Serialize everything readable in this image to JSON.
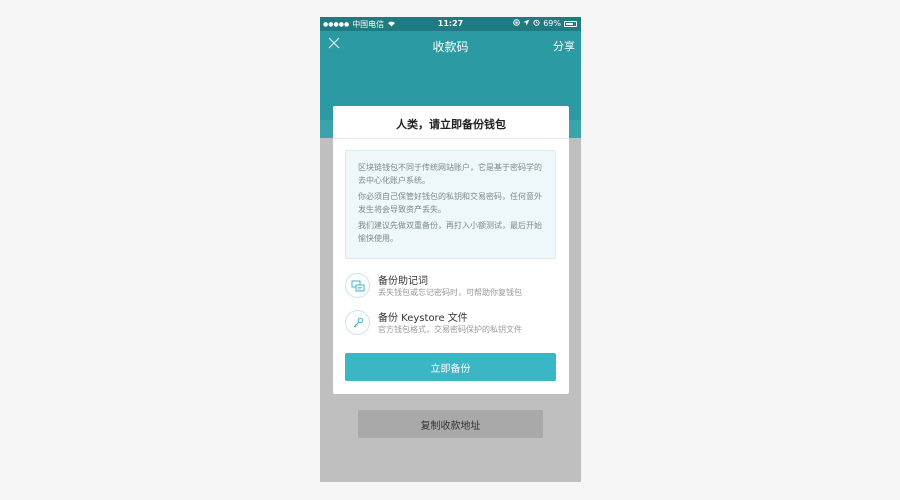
{
  "status_bar": {
    "carrier": "中国电信",
    "time": "11:27",
    "battery": "69%"
  },
  "nav": {
    "close_icon": "close-icon",
    "title": "收款码",
    "share": "分享"
  },
  "background": {
    "copy_address_button": "复制收款地址"
  },
  "modal": {
    "title": "人类，请立即备份钱包",
    "notice": [
      "区块链钱包不同于传统网站账户，它是基于密码学的去中心化账户系统。",
      "你必须自己保管好钱包的私钥和交易密码，任何意外发生将会导致资产丢失。",
      "我们建议先做双重备份，再打入小额测试，最后开始愉快使用。"
    ],
    "options": [
      {
        "icon": "mnemonic-icon",
        "title": "备份助记词",
        "desc": "丢失钱包或忘记密码时，可帮助你复钱包"
      },
      {
        "icon": "key-icon",
        "title": "备份 Keystore 文件",
        "desc": "官方钱包格式，交易密码保护的私钥文件"
      }
    ],
    "primary_button": "立即备份"
  },
  "colors": {
    "header_teal": "#2c9aa3",
    "accent": "#3ab6c5",
    "overlay": "#bfbfbf"
  }
}
